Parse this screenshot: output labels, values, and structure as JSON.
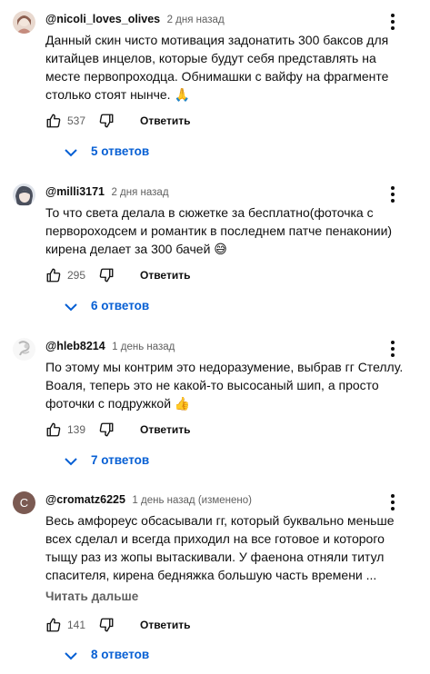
{
  "colors": {
    "link": "#065fd4",
    "meta": "#606060",
    "text": "#0f0f0f"
  },
  "icons": {
    "like": "thumb-up-icon",
    "dislike": "thumb-down-icon",
    "menu": "vertical-dots-icon",
    "expand": "chevron-down-icon"
  },
  "reply_label": "Ответить",
  "read_more_label": "Читать дальше",
  "comments": [
    {
      "author": "@nicoli_loves_olives",
      "time": "2 дня назад",
      "text": "Данный скин чисто мотивация задонатить 300 баксов для\nкитайцев инцелов, которые будут себя представлять на\nместе первопроходца. Обнимашки с вайфу на фрагменте\nстолько стоят нынче. 🙏",
      "likes": "537",
      "replies": "5 ответов"
    },
    {
      "author": "@milli3171",
      "time": "2 дня назад",
      "text": "То что света делала в сюжетке за бесплатно(фоточка с\nпервороходсем и романтик в последнем патче пенаконии)\nкирена делает за 300 бачей 😅",
      "likes": "295",
      "replies": "6 ответов"
    },
    {
      "author": "@hleb8214",
      "time": "1 день назад",
      "text": "По этому мы контрим это недоразумение, выбрав гг Стеллу.\nВоаля, теперь это не какой-то высосаный шип, а просто\nфоточки с подружкой 👍",
      "likes": "139",
      "replies": "7 ответов"
    },
    {
      "author": "@cromatz6225",
      "time": "1 день назад (изменено)",
      "avatar_letter": "C",
      "text": "Весь амфореус обсасывали гг, который буквально меньше\nвсех сделал и всегда приходил на все готовое и которого\nтыщу раз из жопы вытаскивали. У фаенона отняли титул\nспасителя, кирена бедняжка большую часть времени ...",
      "likes": "141",
      "replies": "8 ответов"
    }
  ]
}
